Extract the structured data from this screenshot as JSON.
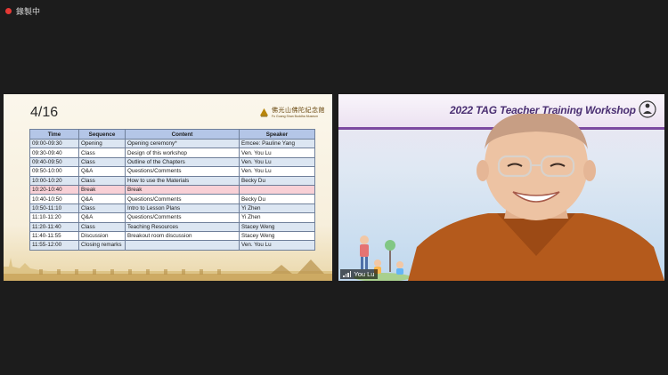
{
  "recording": {
    "label": "錄製中",
    "dot_color": "#e53935"
  },
  "slide": {
    "date": "4/16",
    "logo_cn": "佛光山佛陀紀念館",
    "logo_en": "Fo Guang Shan Buddha Museum",
    "columns": [
      "Time",
      "Sequence",
      "Content",
      "Speaker"
    ],
    "rows": [
      [
        "09:00-09:30",
        "Opening",
        "Opening ceremony*",
        "Emcee: Pauline Yang"
      ],
      [
        "09:30-09:40",
        "Class",
        "Design of this workshop",
        "Ven. You Lu"
      ],
      [
        "09:40-09:50",
        "Class",
        "Outline of the Chapters",
        "Ven. You Lu"
      ],
      [
        "09:50-10:00",
        "Q&A",
        "Questions/Comments",
        "Ven. You Lu"
      ],
      [
        "10:00-10:20",
        "Class",
        "How to use the Materials",
        "Becky Du"
      ],
      [
        "10:20-10:40",
        "Break",
        "Break",
        ""
      ],
      [
        "10:40-10:50",
        "Q&A",
        "Questions/Comments",
        "Becky Du"
      ],
      [
        "10:50-11:10",
        "Class",
        "Intro to Lesson Plans",
        "Yi Zhen"
      ],
      [
        "11:10-11:20",
        "Q&A",
        "Questions/Comments",
        "Yi Zhen"
      ],
      [
        "11:20-11:40",
        "Class",
        "Teaching Resources",
        "Stacey Weng"
      ],
      [
        "11:40-11:55",
        "Discussion",
        "Breakout room discussion",
        "Stacey Weng"
      ],
      [
        "11:55-12:00",
        "Closing remarks",
        "",
        "Ven. You Lu"
      ]
    ]
  },
  "video": {
    "banner_text": "2022 TAG Teacher Training Workshop",
    "participant_name": "You Lu",
    "accent_color": "#7c4aa0"
  }
}
